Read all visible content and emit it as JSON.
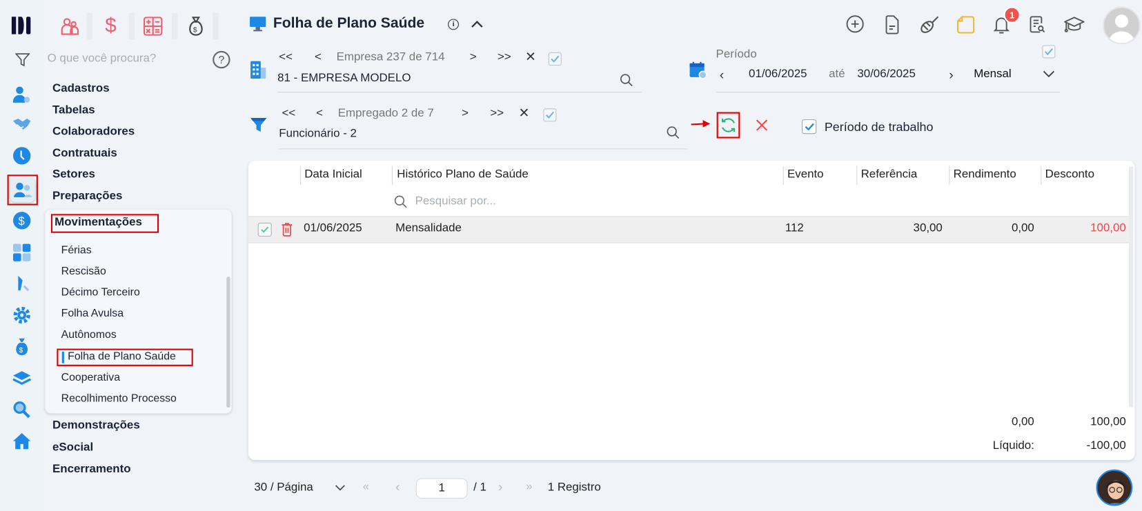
{
  "app": {
    "title": "Folha de Plano Saúde",
    "search_placeholder": "O que você procura?"
  },
  "sidebar": {
    "menu": [
      "Cadastros",
      "Tabelas",
      "Colaboradores",
      "Contratuais",
      "Setores",
      "Preparações"
    ],
    "open_section": "Movimentações",
    "sub_items": [
      "Férias",
      "Rescisão",
      "Décimo Terceiro",
      "Folha Avulsa",
      "Autônomos",
      "Folha de Plano Saúde",
      "Cooperativa",
      "Recolhimento Processo"
    ],
    "active_sub": "Folha de Plano Saúde",
    "menu_after": [
      "Demonstrações",
      "eSocial",
      "Encerramento"
    ]
  },
  "header": {
    "notification_count": "1"
  },
  "empresa": {
    "nav_first": "<<",
    "nav_prev": "<",
    "label": "Empresa",
    "index": "237",
    "of": "de",
    "total": "714",
    "nav_next": ">",
    "nav_last": ">>",
    "value": "81 - EMPRESA MODELO",
    "checked": true
  },
  "periodo": {
    "label": "Período",
    "start": "01/06/2025",
    "between": "até",
    "end": "30/06/2025",
    "type": "Mensal",
    "checked": true
  },
  "empregado": {
    "nav_first": "<<",
    "nav_prev": "<",
    "label": "Empregado 2 de 7",
    "nav_next": ">",
    "nav_last": ">>",
    "value": "Funcionário - 2",
    "checked": true
  },
  "periodo_trabalho": {
    "label": "Período de trabalho",
    "checked": true
  },
  "table": {
    "columns": [
      "Data Inicial",
      "Histórico Plano de Saúde",
      "Evento",
      "Referência",
      "Rendimento",
      "Desconto"
    ],
    "search_placeholder": "Pesquisar por...",
    "rows": [
      {
        "data_inicial": "01/06/2025",
        "historico": "Mensalidade",
        "evento": "112",
        "referencia": "30,00",
        "rendimento": "0,00",
        "desconto": "100,00"
      }
    ],
    "totals": {
      "rendimento": "0,00",
      "desconto": "100,00",
      "liquido_label": "Líquido:",
      "liquido": "-100,00"
    }
  },
  "pagination": {
    "per_page": "30 / Página",
    "page": "1",
    "of_pages": "/ 1",
    "records": "1 Registro"
  },
  "colors": {
    "accent": "#1e88e5",
    "danger": "#f04848",
    "success": "#2bb673",
    "highlight": "#e00000"
  }
}
